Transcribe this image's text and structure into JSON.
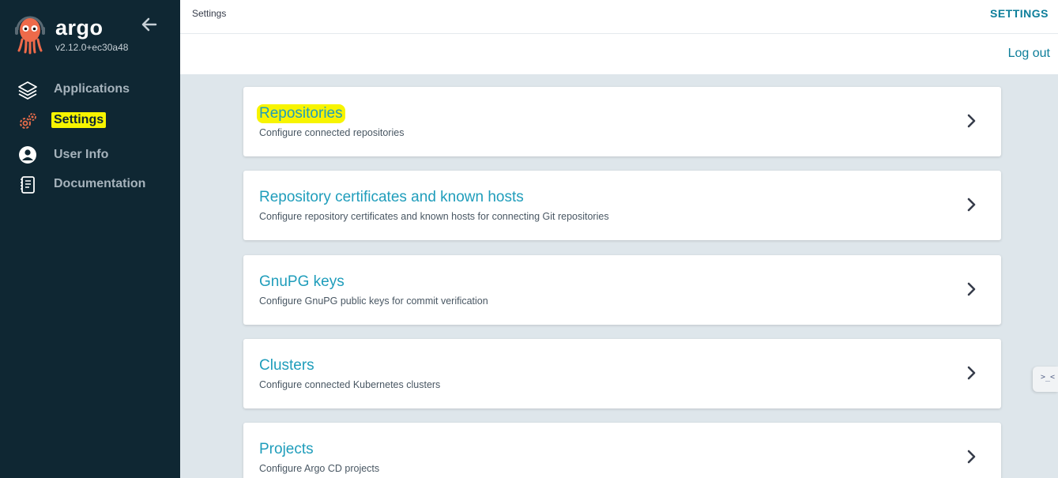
{
  "app": {
    "brand": "argo",
    "version": "v2.12.0+ec30a48"
  },
  "sidebar": {
    "items": [
      {
        "label": "Applications",
        "icon": "layers-icon",
        "active": false
      },
      {
        "label": "Settings",
        "icon": "gears-icon",
        "active": true
      },
      {
        "label": "User Info",
        "icon": "user-circle-icon",
        "active": false
      },
      {
        "label": "Documentation",
        "icon": "book-icon",
        "active": false
      }
    ]
  },
  "topbar": {
    "breadcrumb": "Settings",
    "title": "SETTINGS",
    "logout_label": "Log out"
  },
  "cards": [
    {
      "title": "Repositories",
      "description": "Configure connected repositories",
      "highlighted": true
    },
    {
      "title": "Repository certificates and known hosts",
      "description": "Configure repository certificates and known hosts for connecting Git repositories",
      "highlighted": false
    },
    {
      "title": "GnuPG keys",
      "description": "Configure GnuPG public keys for commit verification",
      "highlighted": false
    },
    {
      "title": "Clusters",
      "description": "Configure connected Kubernetes clusters",
      "highlighted": false
    },
    {
      "title": "Projects",
      "description": "Configure Argo CD projects",
      "highlighted": false
    }
  ],
  "side_tab": {
    "label": ">_<"
  },
  "colors": {
    "sidebar_bg": "#0f2733",
    "accent": "#1f9dbb",
    "highlight": "#f7f400",
    "settings_icon": "#e96d4a"
  }
}
